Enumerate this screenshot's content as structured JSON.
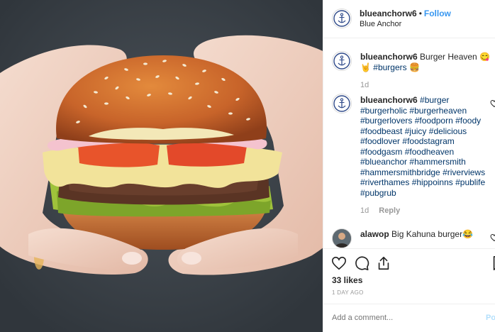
{
  "header": {
    "username": "blueanchorw6",
    "separator": "•",
    "follow_label": "Follow",
    "location": "Blue Anchor"
  },
  "comments": [
    {
      "username": "blueanchorw6",
      "text_before_tag": " Burger Heaven 😋🤘 ",
      "tags": [
        "#burgers"
      ],
      "text_after": " 🍔",
      "age": "1d"
    },
    {
      "username": "blueanchorw6",
      "tags": [
        "#burger",
        "#burgerholic",
        "#burgerheaven",
        "#burgerlovers",
        "#foodporn",
        "#foody",
        "#foodbeast",
        "#juicy",
        "#delicious",
        "#foodlover",
        "#foodstagram",
        "#foodgasm",
        "#foodheaven",
        "#blueanchor",
        "#hammersmith",
        "#hammersmithbridge",
        "#riverviews",
        "#riverthames",
        "#hippoinns",
        "#publife",
        "#pubgrub"
      ],
      "age": "1d",
      "reply_label": "Reply"
    },
    {
      "username": "alawop",
      "text": " Big Kahuna burger😂"
    }
  ],
  "likes": "33 likes",
  "timestamp": "1 DAY AGO",
  "add_comment_placeholder": "Add a comment...",
  "post_label": "Post",
  "icons": [
    "anchor-logo-icon",
    "heart-icon",
    "comment-icon",
    "share-icon",
    "bookmark-icon"
  ],
  "colors": {
    "link": "#003569",
    "follow": "#3897f0",
    "muted": "#999999",
    "post": "#b2dffc",
    "border": "#efefef"
  }
}
